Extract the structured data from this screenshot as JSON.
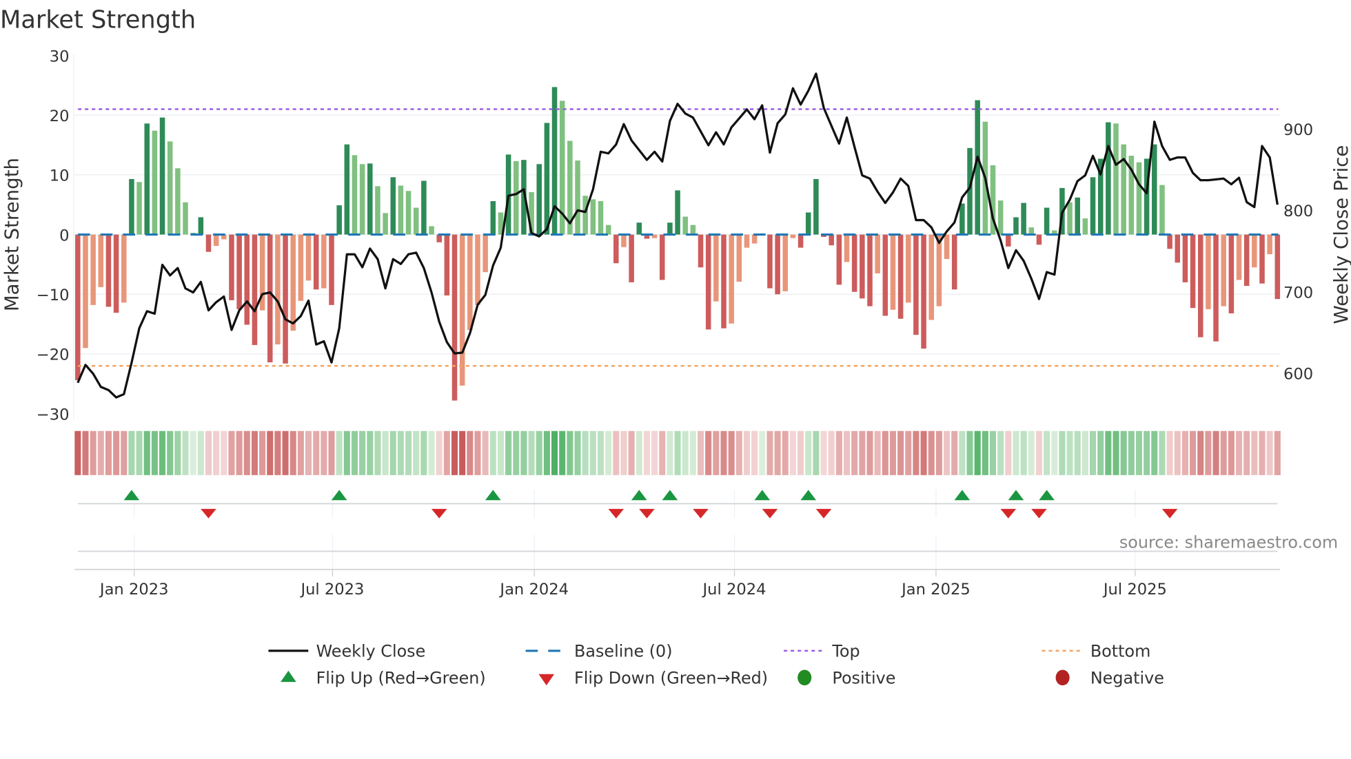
{
  "title": "Market Strength",
  "source": "source: sharemaestro.com",
  "chart_data": {
    "type": "bar",
    "title": "Market Strength",
    "ylabel": "Market Strength",
    "y2label": "Weekly Close Price",
    "ylim": [
      -30,
      30
    ],
    "y2lim": [
      555,
      985
    ],
    "x_interval": "weekly",
    "y_ticks": [
      "30",
      "20",
      "10",
      "0",
      "−10",
      "−20",
      "−30"
    ],
    "y_tick_values": [
      30,
      20,
      10,
      0,
      -10,
      -20,
      -30
    ],
    "y2_ticks": [
      "900",
      "800",
      "700",
      "600"
    ],
    "y2_tick_values": [
      900,
      800,
      700,
      600
    ],
    "x_ticks": [
      "Jan 2023",
      "Jul 2023",
      "Jan 2024",
      "Jul 2024",
      "Jan 2025",
      "Jul 2025"
    ],
    "top_level": 21,
    "bottom_level": -22,
    "baseline": 0,
    "strength": [
      -24.4,
      -19,
      -11.8,
      -8.8,
      -12.1,
      -13.1,
      -11.4,
      9.3,
      8.8,
      18.6,
      17.4,
      19.6,
      15.6,
      11.1,
      5.4,
      0.3,
      2.9,
      -2.9,
      -1.9,
      -0.8,
      -11,
      -12.5,
      -15.1,
      -18.5,
      -12.7,
      -21.4,
      -18.4,
      -21.6,
      -16.1,
      -11.1,
      -7.7,
      -9.2,
      -9,
      -11.8,
      4.9,
      15.1,
      13.3,
      11.8,
      11.9,
      8.1,
      3.6,
      9.6,
      8.2,
      7.3,
      4.5,
      9.0,
      1.4,
      -1.3,
      -10.2,
      -27.8,
      -25.3,
      -16,
      -11.8,
      -6.3,
      5.6,
      3.7,
      13.4,
      12.3,
      12.5,
      7.1,
      11.8,
      18.7,
      24.7,
      22.4,
      15.7,
      12.4,
      6.5,
      5.9,
      5.6,
      1.6,
      -4.8,
      -2.1,
      -8,
      2,
      -0.7,
      -0.6,
      -7.6,
      2,
      7.4,
      3.0,
      1.6,
      -5.5,
      -15.9,
      -11.2,
      -15.7,
      -14.9,
      -7.9,
      -2.2,
      -1.5,
      0.2,
      -9,
      -10,
      -9.5,
      -0.6,
      -2.2,
      3.7,
      9.3,
      -0.4,
      -1.8,
      -8.4,
      -4.6,
      -9.6,
      -10.7,
      -12,
      -6.5,
      -13.6,
      -12.6,
      -14.1,
      -11.4,
      -16.8,
      -19.1,
      -14.3,
      -12,
      -4.1,
      -9.2,
      5.2,
      14.5,
      22.5,
      18.9,
      11.6,
      5.7,
      -2,
      2.9,
      5.3,
      1.2,
      -1.7,
      4.5,
      0.7,
      7.8,
      5.4,
      6.2,
      2.7,
      9.6,
      12.7,
      18.8,
      18.6,
      15.1,
      13.2,
      12.1,
      12.7,
      15.1,
      8.3,
      -2.4,
      -4.7,
      -8,
      -12.3,
      -17.2,
      -12.5,
      -17.9,
      -12,
      -13.2,
      -7.6,
      -8.6,
      -5.5,
      -8.2,
      -3.3,
      -10.8
    ],
    "strength_shade_strong": [
      1,
      0,
      0,
      0,
      1,
      1,
      0,
      1,
      0,
      1,
      0,
      1,
      0,
      0,
      0,
      0,
      1,
      1,
      0,
      0,
      1,
      1,
      1,
      1,
      0,
      1,
      0,
      1,
      0,
      0,
      0,
      1,
      0,
      1,
      1,
      1,
      0,
      0,
      1,
      0,
      0,
      1,
      0,
      0,
      0,
      1,
      0,
      1,
      1,
      1,
      0,
      0,
      0,
      0,
      1,
      0,
      1,
      0,
      1,
      0,
      1,
      1,
      1,
      0,
      0,
      0,
      0,
      0,
      0,
      0,
      1,
      0,
      1,
      1,
      1,
      0,
      1,
      1,
      1,
      0,
      0,
      1,
      1,
      0,
      1,
      0,
      0,
      0,
      0,
      0,
      1,
      1,
      0,
      0,
      1,
      1,
      1,
      1,
      1,
      1,
      0,
      1,
      1,
      1,
      0,
      1,
      0,
      1,
      0,
      1,
      1,
      0,
      0,
      0,
      1,
      1,
      1,
      1,
      0,
      0,
      0,
      1,
      1,
      1,
      0,
      1,
      1,
      0,
      1,
      0,
      1,
      0,
      1,
      1,
      1,
      0,
      0,
      0,
      0,
      1,
      1,
      0,
      1,
      1,
      1,
      1,
      1,
      0,
      1,
      0,
      1,
      0,
      1,
      0,
      1,
      0,
      1
    ],
    "weekly_close": [
      588,
      610,
      599,
      583,
      579,
      570,
      574,
      613,
      655,
      676,
      673,
      733,
      720,
      729,
      704,
      699,
      712,
      677,
      687,
      694,
      653,
      677,
      688,
      676,
      697,
      699,
      688,
      666,
      661,
      670,
      689,
      635,
      639,
      613,
      655,
      746,
      746,
      730,
      753,
      740,
      704,
      740,
      734,
      746,
      748,
      729,
      699,
      663,
      638,
      624,
      625,
      649,
      684,
      696,
      732,
      754,
      818,
      820,
      826,
      772,
      768,
      777,
      805,
      796,
      784,
      800,
      798,
      826,
      872,
      870,
      881,
      906,
      886,
      874,
      862,
      872,
      860,
      910,
      931,
      919,
      914,
      897,
      880,
      896,
      881,
      902,
      913,
      924,
      912,
      929,
      871,
      907,
      918,
      950,
      930,
      947,
      968,
      926,
      904,
      882,
      914,
      878,
      843,
      839,
      823,
      809,
      822,
      839,
      830,
      788,
      788,
      779,
      760,
      774,
      785,
      816,
      828,
      866,
      840,
      790,
      763,
      729,
      751,
      738,
      716,
      691,
      724,
      721,
      797,
      813,
      836,
      843,
      867,
      844,
      879,
      856,
      863,
      850,
      832,
      821,
      909,
      879,
      862,
      865,
      865,
      846,
      837,
      837,
      838,
      839,
      832,
      840,
      810,
      804,
      879,
      865,
      807
    ],
    "flip_up_weeks": [
      8,
      35,
      55,
      74,
      78,
      90,
      96,
      116,
      123,
      127
    ],
    "flip_down_weeks": [
      18,
      48,
      71,
      75,
      82,
      91,
      98,
      122,
      126,
      143
    ],
    "legend": {
      "placement": "bottom",
      "items": [
        "Weekly Close",
        "Baseline (0)",
        "Top",
        "Bottom",
        "Flip Up (Red→Green)",
        "Flip Down (Green→Red)",
        "Positive",
        "Negative"
      ]
    },
    "colors": {
      "pos_strong": "#2e8b57",
      "pos_weak": "#80c080",
      "neg_strong": "#cd5c5c",
      "neg_weak": "#e8967a",
      "baseline": "#1f77b4",
      "top": "#9b5de5",
      "bottom": "#f4a460",
      "close": "#111111",
      "flip_up": "#1a9641",
      "flip_down": "#d62728",
      "positive_dot": "#228b22",
      "negative_dot": "#b22222"
    }
  }
}
